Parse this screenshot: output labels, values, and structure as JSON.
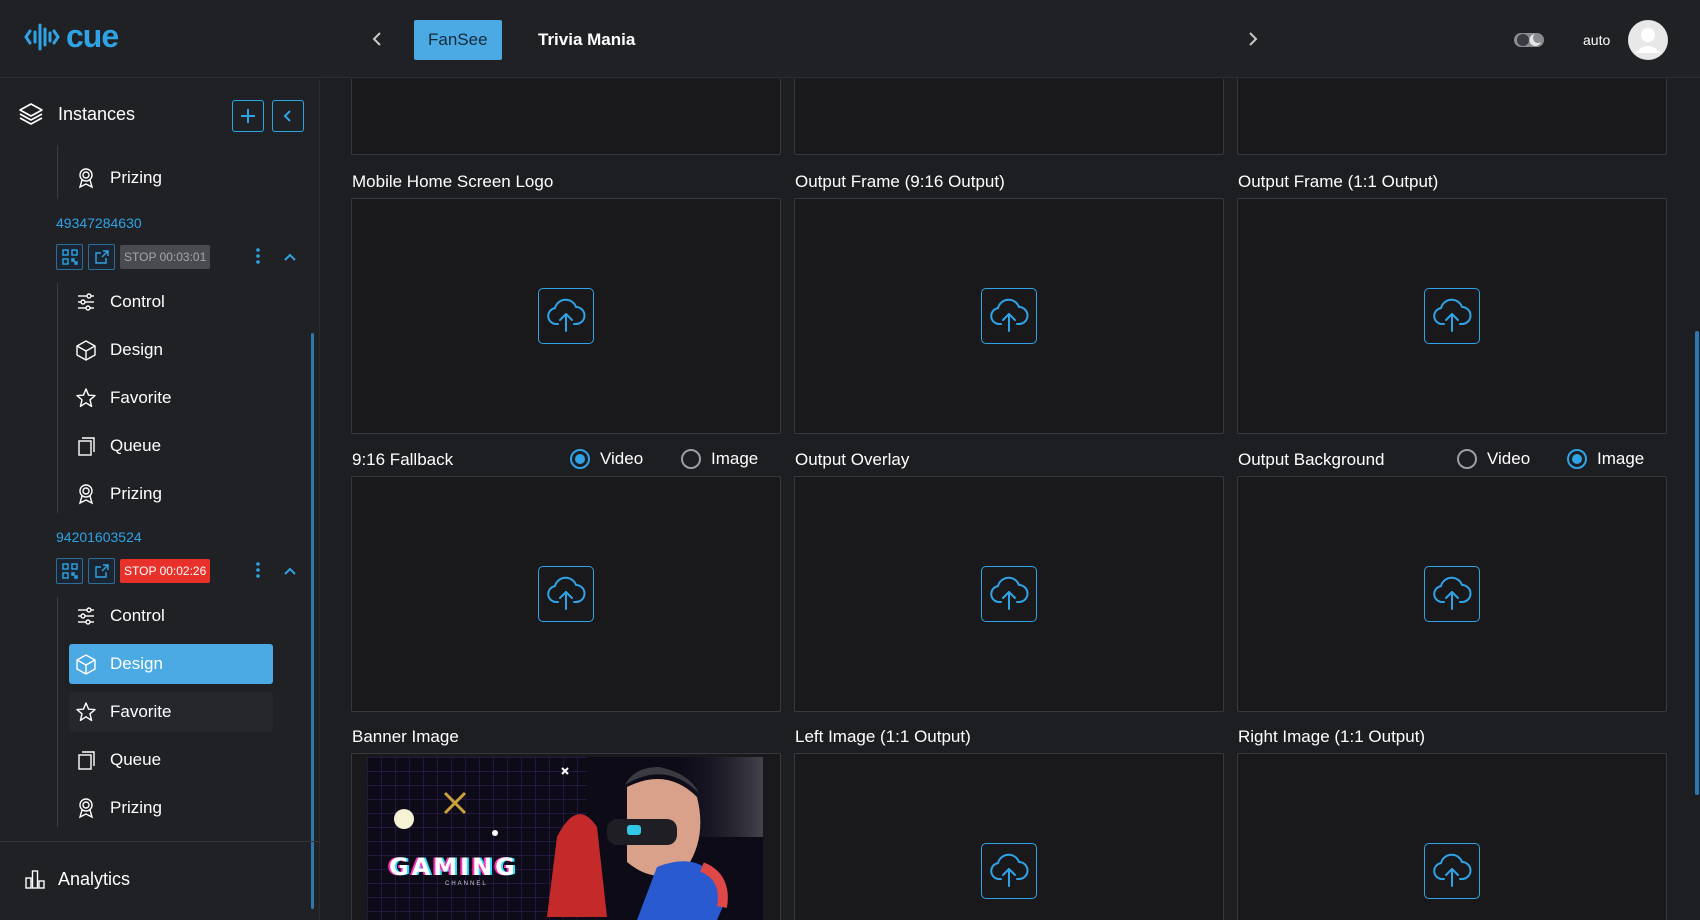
{
  "header": {
    "logo_text": "cue",
    "tabs": [
      {
        "label": "FanSee",
        "active": true
      },
      {
        "label": "Trivia Mania",
        "active": false
      }
    ],
    "theme_label": "auto"
  },
  "sidebar": {
    "title": "Instances",
    "first_group_items": [
      {
        "label": "Prizing",
        "icon": "award-icon"
      }
    ],
    "instances": [
      {
        "id": "49347284630",
        "stop_label": "STOP 00:03:01",
        "stop_style": "grey",
        "items": [
          {
            "label": "Control",
            "icon": "sliders-icon"
          },
          {
            "label": "Design",
            "icon": "cube-icon"
          },
          {
            "label": "Favorite",
            "icon": "star-icon"
          },
          {
            "label": "Queue",
            "icon": "queue-icon"
          },
          {
            "label": "Prizing",
            "icon": "award-icon"
          }
        ]
      },
      {
        "id": "94201603524",
        "stop_label": "STOP 00:02:26",
        "stop_style": "red",
        "items": [
          {
            "label": "Control",
            "icon": "sliders-icon"
          },
          {
            "label": "Design",
            "icon": "cube-icon",
            "selected": true
          },
          {
            "label": "Favorite",
            "icon": "star-icon",
            "hovered": true
          },
          {
            "label": "Queue",
            "icon": "queue-icon"
          },
          {
            "label": "Prizing",
            "icon": "award-icon"
          }
        ]
      }
    ],
    "footer_item": "Analytics"
  },
  "content": {
    "fields": {
      "mobile_logo": "Mobile Home Screen Logo",
      "frame_916": "Output Frame (9:16 Output)",
      "frame_11": "Output Frame (1:1 Output)",
      "fallback_916": "9:16 Fallback",
      "overlay": "Output Overlay",
      "background": "Output Background",
      "banner": "Banner Image",
      "left_image": "Left Image (1:1 Output)",
      "right_image": "Right Image (1:1 Output)"
    },
    "fallback_radios": {
      "video": "Video",
      "image": "Image",
      "selected": "Video"
    },
    "background_radios": {
      "video": "Video",
      "image": "Image",
      "selected": "Image"
    },
    "banner_preview": {
      "title": "GAMING",
      "subtitle": "CHANNEL"
    }
  },
  "colors": {
    "accent": "#2fa3e6",
    "selected_bg": "#4ba9e4",
    "stop_red": "#e8312b",
    "background": "#1d1e22"
  }
}
